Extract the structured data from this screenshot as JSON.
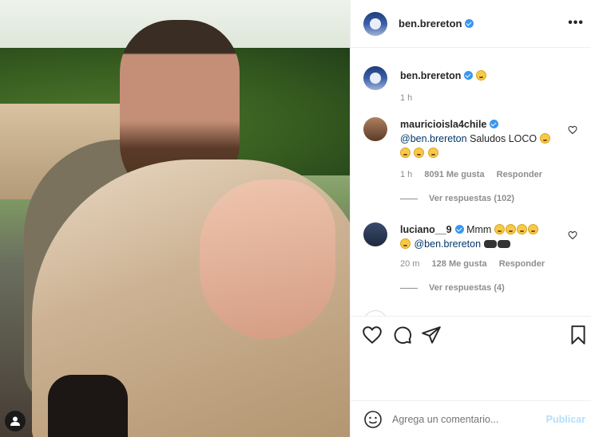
{
  "post": {
    "author": "ben.brereton",
    "more_label": "•••"
  },
  "caption": {
    "author": "ben.brereton",
    "emoji": "wink-emoji",
    "time": "1 h"
  },
  "comments": [
    {
      "author": "mauricioisla4chile",
      "mention": "@ben.brereton",
      "text": "Saludos LOCO",
      "emojis": [
        "grin-emoji",
        "grin-emoji",
        "grin-emoji",
        "grin-emoji"
      ],
      "time": "1 h",
      "likes": "8091 Me gusta",
      "reply": "Responder",
      "view_replies": "Ver respuestas (102)"
    },
    {
      "author": "luciano__9",
      "text": "Mmm",
      "mention": "@ben.brereton",
      "emojis": [
        "wink-emoji",
        "wink-emoji",
        "wink-emoji",
        "rofl-emoji",
        "rofl-emoji"
      ],
      "pads": [
        "gamepad-emoji",
        "gamepad-emoji"
      ],
      "time": "20 m",
      "likes": "128 Me gusta",
      "reply": "Responder",
      "view_replies": "Ver respuestas (4)"
    }
  ],
  "add_comment": {
    "placeholder": "Agrega un comentario...",
    "post_label": "Publicar"
  },
  "colors": {
    "verified": "#3897f0",
    "link": "#00376b",
    "muted": "#8e8e8e",
    "publish_disabled": "#b2dffc"
  }
}
